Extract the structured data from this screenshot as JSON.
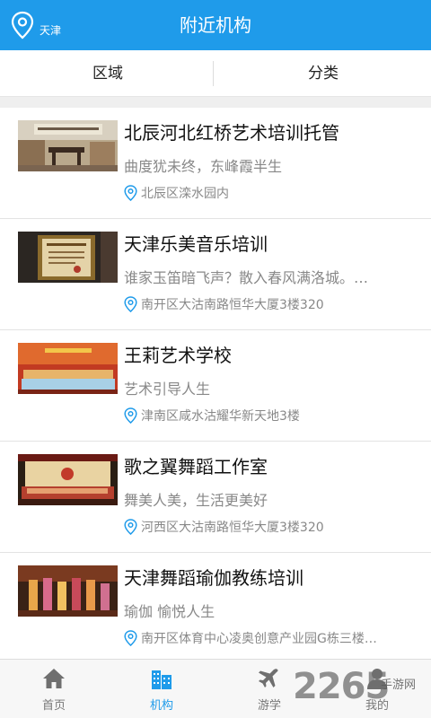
{
  "header": {
    "location": "天津",
    "title": "附近机构",
    "accent": "#1f9bea"
  },
  "filters": {
    "region": "区域",
    "category": "分类"
  },
  "items": [
    {
      "name": "北辰河北红桥艺术培训托管",
      "slogan": "曲度犹未终，东峰霞半生",
      "address": "北辰区滦水园内",
      "thumb": "calligraphy-room-photo"
    },
    {
      "name": "天津乐美音乐培训",
      "slogan": "谁家玉笛暗飞声？散入春风满洛城。…",
      "address": "南开区大沽南路恒华大厦3楼320",
      "thumb": "framed-certificate-photo"
    },
    {
      "name": "王莉艺术学校",
      "slogan": "艺术引导人生",
      "address": "津南区咸水沽耀华新天地3楼",
      "thumb": "stage-performance-photo"
    },
    {
      "name": "歌之翼舞蹈工作室",
      "slogan": "舞美人美，生活更美好",
      "address": "河西区大沽南路恒华大厦3楼320",
      "thumb": "dance-stage-photo"
    },
    {
      "name": "天津舞蹈瑜伽教练培训",
      "slogan": "瑜伽 愉悦人生",
      "address": "南开区体育中心凌奥创意产业园G栋三楼…",
      "thumb": "dance-group-photo"
    }
  ],
  "nav": [
    {
      "label": "首页",
      "icon": "home-icon"
    },
    {
      "label": "机构",
      "icon": "building-icon",
      "active": true
    },
    {
      "label": "游学",
      "icon": "airplane-icon"
    },
    {
      "label": "我的",
      "icon": "user-icon"
    }
  ],
  "watermark": {
    "number": "2265",
    "text": "手游网"
  }
}
